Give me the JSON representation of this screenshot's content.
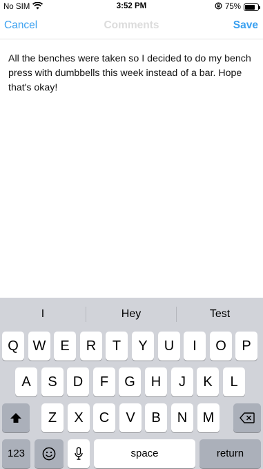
{
  "status_bar": {
    "carrier": "No SIM",
    "time": "3:52 PM",
    "battery_percent": "75%",
    "battery_level": 0.75,
    "icons": [
      "wifi-icon",
      "orientation-lock-icon",
      "battery-icon"
    ]
  },
  "nav": {
    "cancel_label": "Cancel",
    "title": "Comments",
    "save_label": "Save"
  },
  "comment": {
    "text": "All the benches were taken so I decided to do my bench press with dumbbells this week instead of a bar. Hope that's okay!"
  },
  "keyboard": {
    "suggestions": [
      "I",
      "Hey",
      "Test"
    ],
    "row1": [
      "Q",
      "W",
      "E",
      "R",
      "T",
      "Y",
      "U",
      "I",
      "O",
      "P"
    ],
    "row2": [
      "A",
      "S",
      "D",
      "F",
      "G",
      "H",
      "J",
      "K",
      "L"
    ],
    "row3": [
      "Z",
      "X",
      "C",
      "V",
      "B",
      "N",
      "M"
    ],
    "numbers_label": "123",
    "space_label": "space",
    "return_label": "return",
    "icons": [
      "shift-icon",
      "delete-icon",
      "emoji-icon",
      "microphone-icon"
    ]
  }
}
